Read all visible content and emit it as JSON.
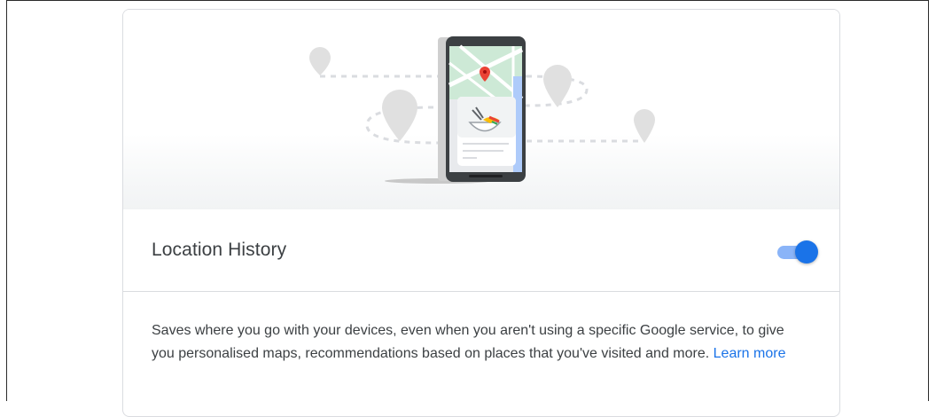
{
  "setting": {
    "title": "Location History",
    "enabled": true,
    "description": "Saves where you go with your devices, even when you aren't using a specific Google service, to give you personalised maps, recommendations based on places that you've visited and more.",
    "learn_more_label": "Learn more"
  },
  "illustration": {
    "icons": [
      "map-pin-icon",
      "smartphone-icon",
      "food-bowl-icon"
    ]
  },
  "colors": {
    "toggle_thumb": "#1a73e8",
    "toggle_track": "#8ab4f8",
    "link": "#1a73e8",
    "pin_red": "#ea4335",
    "text": "#3c4043"
  }
}
